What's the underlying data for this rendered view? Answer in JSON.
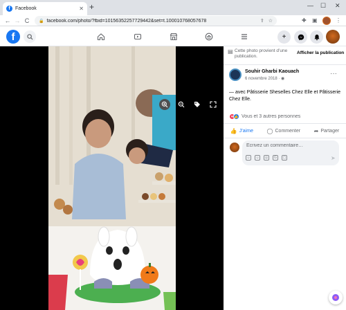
{
  "browser": {
    "tab_title": "Facebook",
    "tab_close": "✕",
    "new_tab": "+",
    "minimize": "—",
    "maximize": "☐",
    "close": "✕",
    "back": "←",
    "forward": "→",
    "reload": "C",
    "url": "facebook.com/photo/?fbid=1015635225772944​2&set=t.100010768057678"
  },
  "colors": {
    "brand": "#1877f2",
    "like": "#1877f2",
    "love": "#f33e58"
  },
  "fbnav": {
    "logo": "f"
  },
  "side": {
    "notice_text": "Cette photo provient d’une publication.",
    "notice_button": "Afficher la publication",
    "poster_name": "Souhir Gharbi Kaouach",
    "poster_date": "6 novembre 2018 · ",
    "more": "···",
    "caption": "— avec Pâtisserie Sheselles Chez Elle et Pâtisserie Chez Elle.",
    "reactions_text": "Vous et 3 autres personnes",
    "like_label": "J’aime",
    "comment_label": "Commenter",
    "share_label": "Partager",
    "comment_placeholder": "Écrivez un commentaire…"
  }
}
